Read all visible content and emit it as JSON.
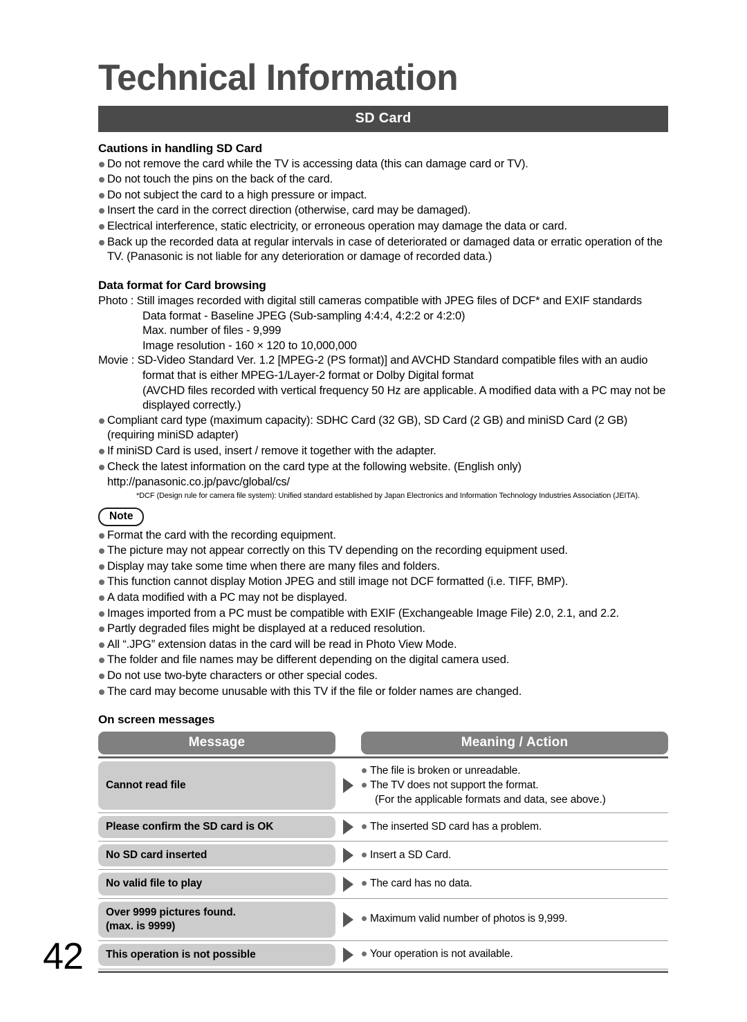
{
  "page": {
    "title": "Technical Information",
    "section_bar": "SD Card",
    "page_number": "42"
  },
  "cautions": {
    "heading": "Cautions in handling SD Card",
    "items": [
      "Do not remove the card while the TV is accessing data (this can damage card or TV).",
      "Do not touch the pins on the back of the card.",
      "Do not subject the card to a high pressure or impact.",
      "Insert the card in the correct direction (otherwise, card may be damaged).",
      "Electrical interference, static electricity, or erroneous operation may damage the data or card.",
      "Back up the recorded data at regular intervals in case of deteriorated or damaged data or erratic operation of the TV. (Panasonic is not liable for any deterioration or damage of recorded data.)"
    ]
  },
  "data_format": {
    "heading": "Data format for Card browsing",
    "photo_line": "Photo : Still images recorded with digital still cameras compatible with JPEG files of DCF* and EXIF standards",
    "photo_details": [
      "Data format - Baseline JPEG (Sub-sampling 4:4:4, 4:2:2 or 4:2:0)",
      "Max. number of files - 9,999",
      "Image resolution - 160 × 120 to 10,000,000"
    ],
    "movie_line": "Movie : SD-Video Standard Ver. 1.2 [MPEG-2 (PS format)] and AVCHD Standard compatible files with an audio format that is either MPEG-1/Layer-2 format or Dolby Digital format",
    "movie_details": [
      "(AVCHD files recorded with vertical frequency 50 Hz are applicable. A modified data with a PC may not be displayed correctly.)"
    ],
    "bullets": [
      "Compliant card type (maximum capacity): SDHC Card (32 GB), SD Card (2 GB) and miniSD Card (2 GB) (requiring miniSD adapter)",
      "If miniSD Card is used, insert / remove it together with the adapter.",
      "Check the latest information on the card type at the following website. (English only)"
    ],
    "url": "http://panasonic.co.jp/pavc/global/cs/",
    "footnote": "*DCF (Design rule for camera file system): Unified standard established by Japan Electronics and Information Technology Industries Association (JEITA)."
  },
  "note": {
    "badge": "Note",
    "items": [
      "Format the card with the recording equipment.",
      "The picture may not appear correctly on this TV depending on the recording equipment used.",
      "Display may take some time when there are many files and folders.",
      "This function cannot display Motion JPEG and still image not DCF formatted (i.e. TIFF, BMP).",
      "A data modified with a PC may not be displayed.",
      "Images imported from a PC must be compatible with EXIF (Exchangeable Image File) 2.0, 2.1, and 2.2.",
      "Partly degraded files might be displayed at a reduced resolution.",
      "All “.JPG” extension datas in the card will be read in Photo View Mode.",
      "The folder and file names may be different depending on the digital camera used.",
      "Do not use two-byte characters or other special codes.",
      "The card may become unusable with this TV if the file or folder names are changed."
    ]
  },
  "messages": {
    "heading": "On screen messages",
    "columns": {
      "message": "Message",
      "meaning": "Meaning / Action"
    },
    "rows": [
      {
        "message": "Cannot read file",
        "meanings": [
          "The file is broken or unreadable.",
          "The TV does not support the format."
        ],
        "sub": "(For the applicable formats and data, see above.)"
      },
      {
        "message": "Please confirm the SD card is OK",
        "meanings": [
          "The inserted SD card has a problem."
        ],
        "sub": ""
      },
      {
        "message": "No SD card inserted",
        "meanings": [
          "Insert a SD Card."
        ],
        "sub": ""
      },
      {
        "message": "No valid file to play",
        "meanings": [
          "The card has no data."
        ],
        "sub": ""
      },
      {
        "message": "Over 9999 pictures found.",
        "message_line2": "(max. is 9999)",
        "meanings": [
          "Maximum valid number of photos is 9,999."
        ],
        "sub": ""
      },
      {
        "message": "This operation is not possible",
        "meanings": [
          "Your operation is not available."
        ],
        "sub": ""
      }
    ]
  },
  "colors": {
    "section_bar_bg": "#4a4a4a",
    "header_pill_bg": "#808080",
    "cell_bg": "#cccccc",
    "bullet": "#6e6e6e",
    "arrow": "#555555"
  }
}
